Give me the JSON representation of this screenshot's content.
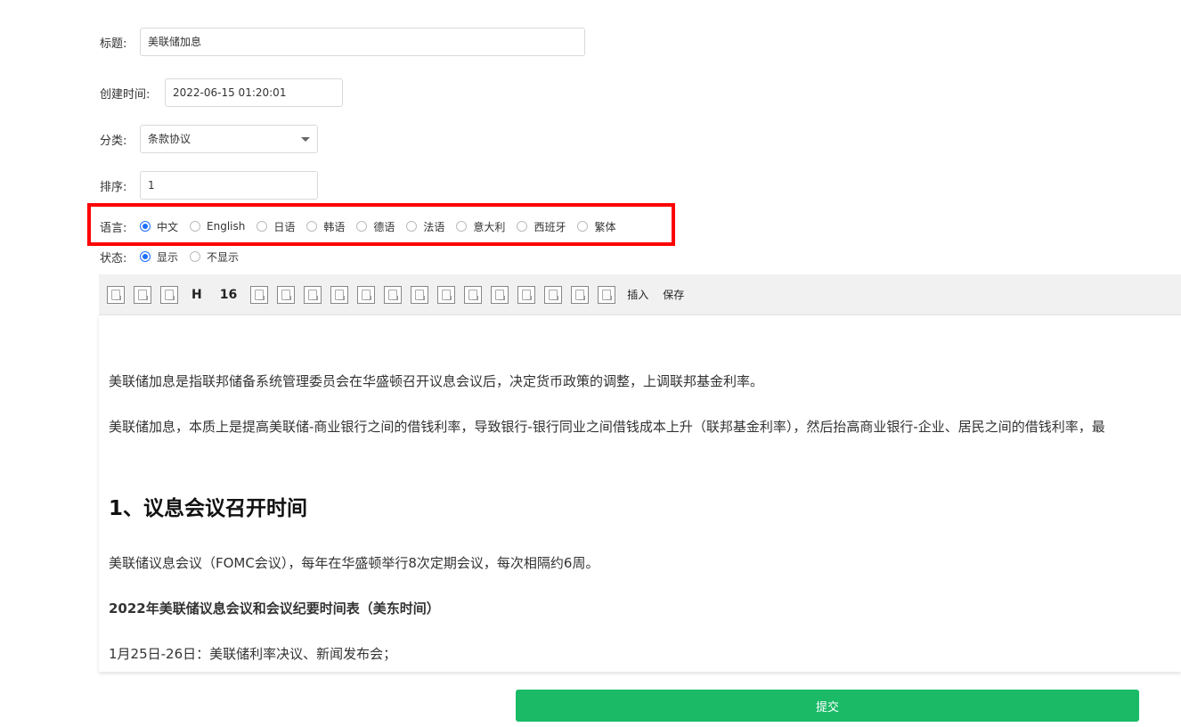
{
  "form": {
    "title_label": "标题:",
    "title_value": "美联储加息",
    "created_label": "创建时间:",
    "created_value": "2022-06-15 01:20:01",
    "category_label": "分类:",
    "category_value": "条款协议",
    "order_label": "排序:",
    "order_value": "1",
    "language_label": "语言:",
    "languages": [
      {
        "label": "中文",
        "checked": true
      },
      {
        "label": "English",
        "checked": false
      },
      {
        "label": "日语",
        "checked": false
      },
      {
        "label": "韩语",
        "checked": false
      },
      {
        "label": "德语",
        "checked": false
      },
      {
        "label": "法语",
        "checked": false
      },
      {
        "label": "意大利",
        "checked": false
      },
      {
        "label": "西班牙",
        "checked": false
      },
      {
        "label": "繁体",
        "checked": false
      }
    ],
    "status_label": "状态:",
    "statuses": [
      {
        "label": "显示",
        "checked": true
      },
      {
        "label": "不显示",
        "checked": false
      }
    ]
  },
  "toolbar": {
    "heading_label": "H",
    "fontsize_label": "16",
    "insert_label": "插入",
    "save_label": "保存"
  },
  "editor": {
    "para1": "美联储加息是指联邦储备系统管理委员会在华盛顿召开议息会议后，决定货币政策的调整，上调联邦基金利率。",
    "para2": "美联储加息，本质上是提高美联储-商业银行之间的借钱利率，导致银行-银行同业之间借钱成本上升（联邦基金利率），然后抬高商业银行-企业、居民之间的借钱利率，最",
    "heading1": "1、议息会议召开时间",
    "para3": "美联储议息会议（FOMC会议），每年在华盛顿举行8次定期会议，每次相隔约6周。",
    "subheading": "2022年美联储议息会议和会议纪要时间表（美东时间）",
    "para4": "1月25日-26日：美联储利率决议、新闻发布会；"
  },
  "submit_label": "提交",
  "colors": {
    "accent": "#1e6fff",
    "submit": "#1aba67",
    "highlight": "#ff0000"
  }
}
